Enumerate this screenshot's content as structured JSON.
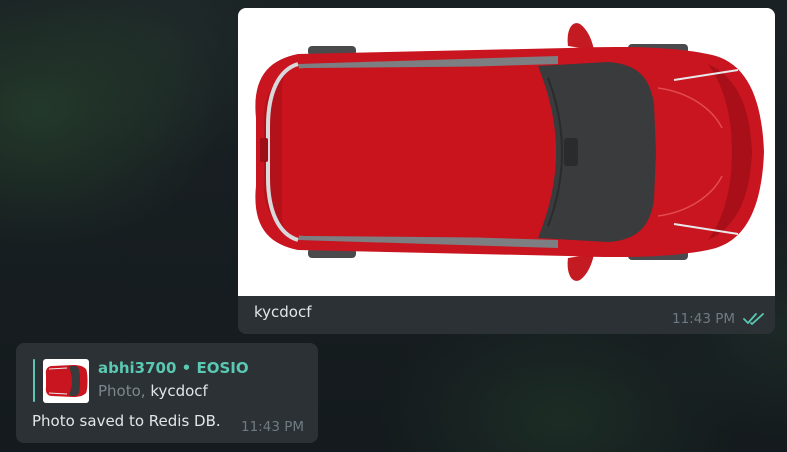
{
  "outgoing_message": {
    "caption": "kycdocf",
    "time": "11:43 PM",
    "status_icon": "double-check-icon",
    "photo_subject": "car-top-view-icon",
    "colors": {
      "car_body": "#c8151f",
      "glass": "#3a3b3d",
      "read_check": "#5ac8b2"
    }
  },
  "incoming_message": {
    "reply": {
      "sender": "abhi3700 • EOSIO",
      "kind": "Photo, ",
      "text": "kycdocf"
    },
    "text": "Photo saved to Redis DB.",
    "time": "11:43 PM"
  },
  "colors": {
    "bubble": "#2b3134",
    "accent": "#5ac8b2",
    "text": "#e3e6e8",
    "muted": "#6f7b82"
  }
}
